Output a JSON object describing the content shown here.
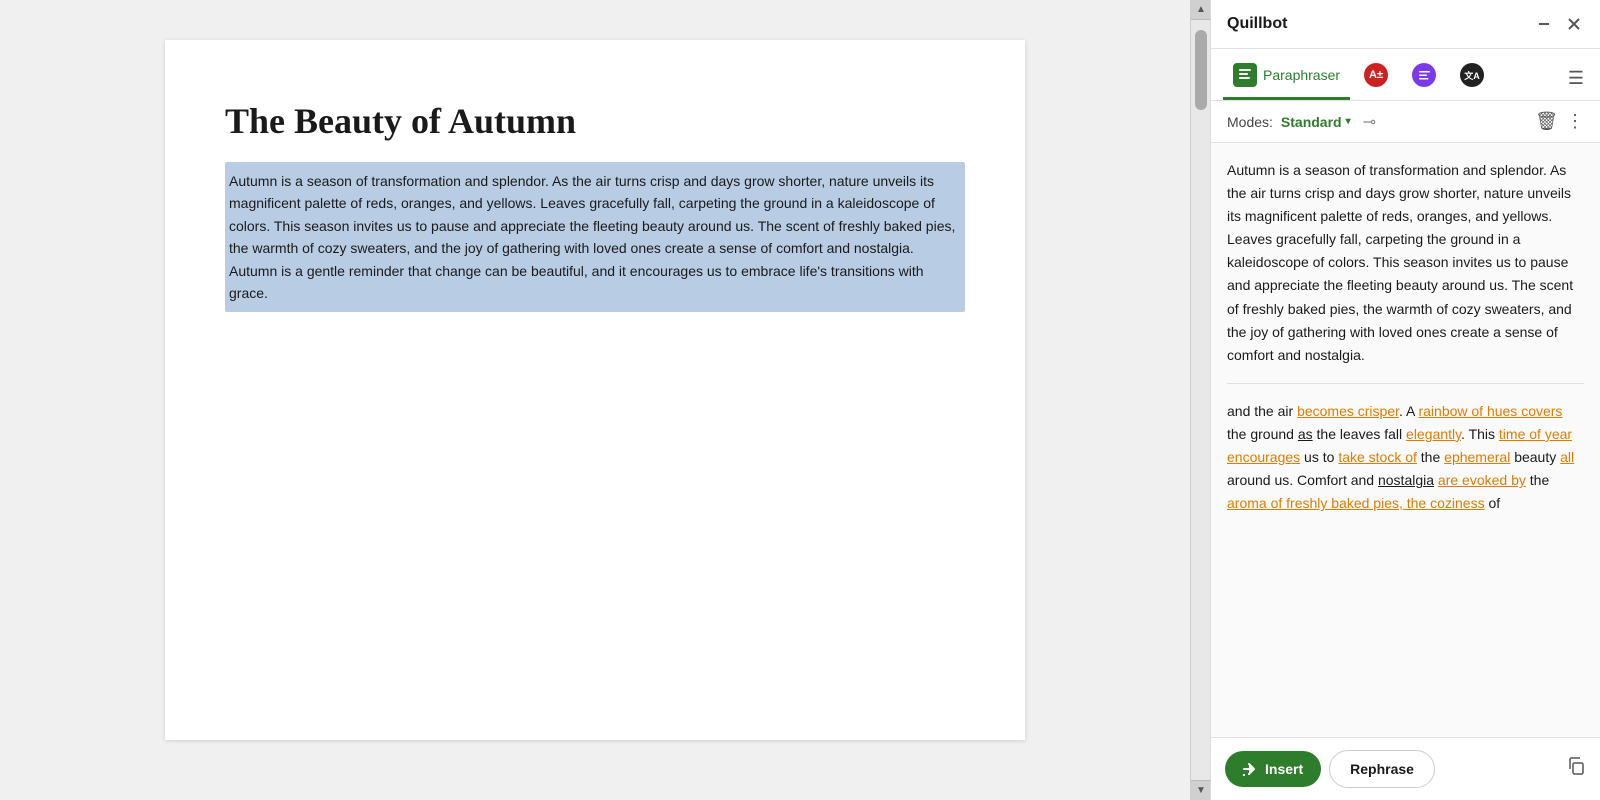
{
  "header": {
    "title": "Quillbot",
    "minimize_label": "minimize",
    "close_label": "close"
  },
  "toolbar": {
    "paraphraser_label": "Paraphraser",
    "grammar_icon": "A±",
    "summarizer_icon": "≡",
    "translate_icon": "文A",
    "menu_icon": "☰"
  },
  "mode_row": {
    "label": "Modes:",
    "mode": "Standard",
    "trash_icon": "🗑",
    "more_icon": "⋮"
  },
  "document": {
    "title": "The Beauty of Autumn",
    "body": "Autumn is a season of transformation and splendor. As the air turns crisp and days grow shorter, nature unveils its magnificent palette of reds, oranges, and yellows. Leaves gracefully fall, carpeting the ground in a kaleidoscope of colors. This season invites us to pause and appreciate the fleeting beauty around us. The scent of freshly baked pies, the warmth of cozy sweaters, and the joy of gathering with loved ones create a sense of comfort and nostalgia. Autumn is a gentle reminder that change can be beautiful, and it encourages us to embrace life's transitions with grace."
  },
  "panel": {
    "original_text": "Autumn is a season of transformation and splendor. As the air turns crisp and days grow shorter, nature unveils its magnificent palette of reds, oranges, and yellows. Leaves gracefully fall, carpeting the ground in a kaleidoscope of colors. This season invites us to pause and appreciate the fleeting beauty around us. The scent of freshly baked pies, the warmth of cozy sweaters, and the joy of gathering with loved ones create a sense of comfort and nostalgia.",
    "rephrased_intro": "and the air ",
    "rephrased_part1": "becomes crisper",
    "rephrased_part2": ". A ",
    "rephrased_part3": "rainbow of hues covers",
    "rephrased_part4": " the ground ",
    "rephrased_part5": "as",
    "rephrased_part6": " the leaves fall ",
    "rephrased_part7": "elegantly",
    "rephrased_part8": ". This ",
    "rephrased_part9": "time of year encourages",
    "rephrased_part10": " us to ",
    "rephrased_part11": "take stock of",
    "rephrased_part12": " the ",
    "rephrased_part13": "ephemeral",
    "rephrased_part14": " beauty ",
    "rephrased_part15": "all",
    "rephrased_part16": " around us. Comfort and ",
    "rephrased_part17": "nostalgia",
    "rephrased_part18": " ",
    "rephrased_part19": "are evoked by",
    "rephrased_part20": " the ",
    "rephrased_part21": "aroma of freshly baked pies, the coziness",
    "rephrased_part22": " of"
  },
  "bottom": {
    "insert_label": "Insert",
    "rephrase_label": "Rephrase",
    "copy_label": "copy"
  }
}
